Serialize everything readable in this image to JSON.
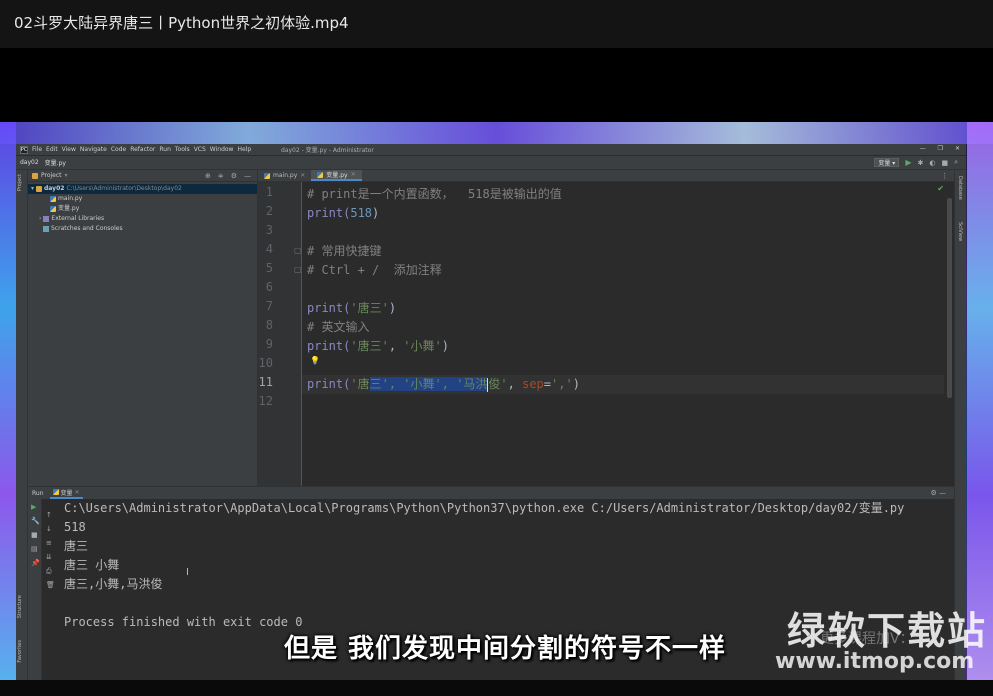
{
  "video_title": "02斗罗大陆异界唐三丨Python世界之初体验.mp4",
  "ide": {
    "menu": [
      "File",
      "Edit",
      "View",
      "Navigate",
      "Code",
      "Refactor",
      "Run",
      "Tools",
      "VCS",
      "Window",
      "Help"
    ],
    "window_title": "day02 - 变量.py - Administrator",
    "breadcrumb": [
      "day02",
      "变量.py"
    ],
    "run_config": "变量",
    "project_label": "Project",
    "tree": {
      "root_name": "day02",
      "root_path": "C:\\Users\\Administrator\\Desktop\\day02",
      "files": [
        "main.py",
        "变量.py"
      ],
      "external": "External Libraries",
      "scratches": "Scratches and Consoles"
    },
    "tabs": [
      "main.py",
      "变量.py"
    ],
    "line_numbers": [
      "1",
      "2",
      "3",
      "4",
      "5",
      "6",
      "7",
      "8",
      "9",
      "10",
      "11",
      "12"
    ],
    "code": {
      "l1": "# print是一个内置函数，  518是被输出的值",
      "l2_fn": "print(",
      "l2_num": "518",
      "l2_end": ")",
      "l4": "# 常用快捷键",
      "l5": "# Ctrl + /  添加注释",
      "l7_fn": "print(",
      "l7_str": "'唐三'",
      "l7_end": ")",
      "l8": "# 英文输入",
      "l9_fn": "print(",
      "l9_s1": "'唐三'",
      "l9_sep": ", ",
      "l9_s2": "'小舞'",
      "l9_end": ")",
      "l11_fn": "print(",
      "l11_a": "'唐",
      "l11_sel1": "三', ",
      "l11_sel2": "'小舞', ",
      "l11_sel3": "'马洪",
      "l11_b": "俊'",
      "l11_c": ", ",
      "l11_kw": "sep",
      "l11_eq": "=",
      "l11_sepstr": "','",
      "l11_end": ")"
    },
    "run": {
      "label": "Run",
      "tab": "变量",
      "output": [
        "C:\\Users\\Administrator\\AppData\\Local\\Programs\\Python\\Python37\\python.exe C:/Users/Administrator/Desktop/day02/变量.py",
        "518",
        "唐三",
        "唐三 小舞",
        "唐三,小舞,马洪俊",
        "",
        "Process finished with exit code 0"
      ]
    },
    "side_left": [
      "Project",
      "Structure",
      "Favorites"
    ],
    "side_right": [
      "Database",
      "SciView"
    ]
  },
  "subtitle": "但是 我们发现中间分割的符号不一样",
  "watermark": {
    "brand": "绿软下载站",
    "overlay": "更多课程加V：",
    "site": "www.itmop.com"
  }
}
